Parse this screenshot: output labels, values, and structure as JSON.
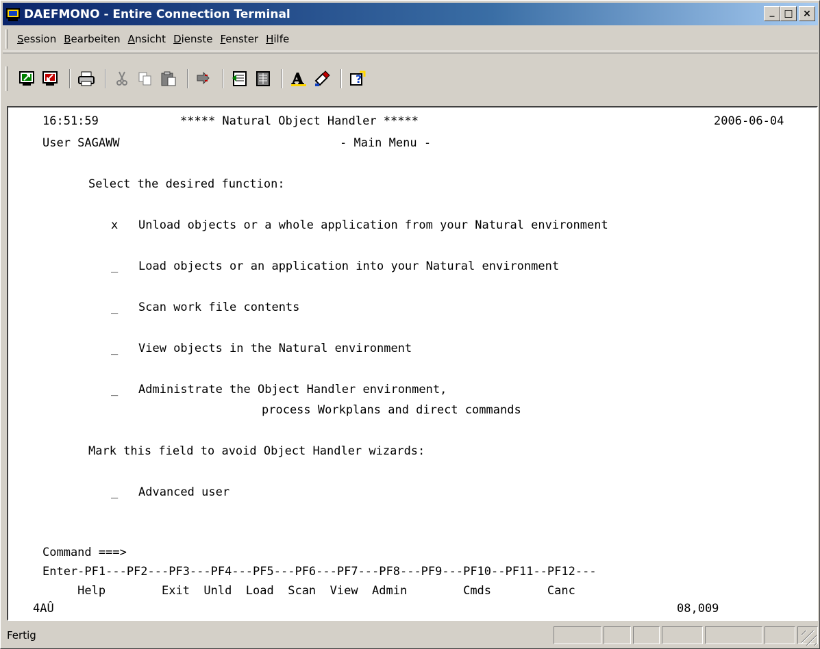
{
  "window": {
    "title": "DAEFMONO - Entire Connection Terminal",
    "controls": {
      "minimize": "_",
      "maximize": "□",
      "close": "×"
    }
  },
  "menubar": {
    "items": [
      {
        "pre": "",
        "acc": "S",
        "post": "ession"
      },
      {
        "pre": "",
        "acc": "B",
        "post": "earbeiten"
      },
      {
        "pre": "",
        "acc": "A",
        "post": "nsicht"
      },
      {
        "pre": "",
        "acc": "D",
        "post": "ienste"
      },
      {
        "pre": "",
        "acc": "F",
        "post": "enster"
      },
      {
        "pre": "",
        "acc": "H",
        "post": "ilfe"
      }
    ]
  },
  "toolbar": {
    "icons": [
      "connect-icon",
      "disconnect-icon",
      "print-icon",
      "cut-icon",
      "copy-icon",
      "paste-icon",
      "transfer-icon",
      "layout-icon",
      "keyboard-icon",
      "font-icon",
      "color-icon",
      "help-icon"
    ]
  },
  "terminal": {
    "time": "16:51:59",
    "header": "***** Natural Object Handler *****",
    "date": "2006-06-04",
    "user": "User SAGAWW",
    "subtitle": "- Main Menu -",
    "prompt": "Select the desired function:",
    "options": [
      {
        "mark": "x",
        "text": "Unload objects or a whole application from your Natural environment"
      },
      {
        "mark": "_",
        "text": "Load objects or an application into your Natural environment"
      },
      {
        "mark": "_",
        "text": "Scan work file contents"
      },
      {
        "mark": "_",
        "text": "View objects in the Natural environment"
      },
      {
        "mark": "_",
        "text": "Administrate the Object Handler environment,"
      }
    ],
    "option5_cont": "process Workplans and direct commands",
    "wizard_prompt": "Mark this field to avoid Object Handler wizards:",
    "advanced": {
      "mark": "_",
      "text": "Advanced user"
    },
    "command_label": "Command ===>",
    "pf_keys": "Enter-PF1---PF2---PF3---PF4---PF5---PF6---PF7---PF8---PF9---PF10--PF11--PF12---",
    "pf_labels": "     Help        Exit  Unld  Load  Scan  View  Admin        Cmds        Canc",
    "status_left": "4AÛ",
    "cursor_pos": "08,009"
  },
  "statusbar": {
    "text": "Fertig"
  }
}
